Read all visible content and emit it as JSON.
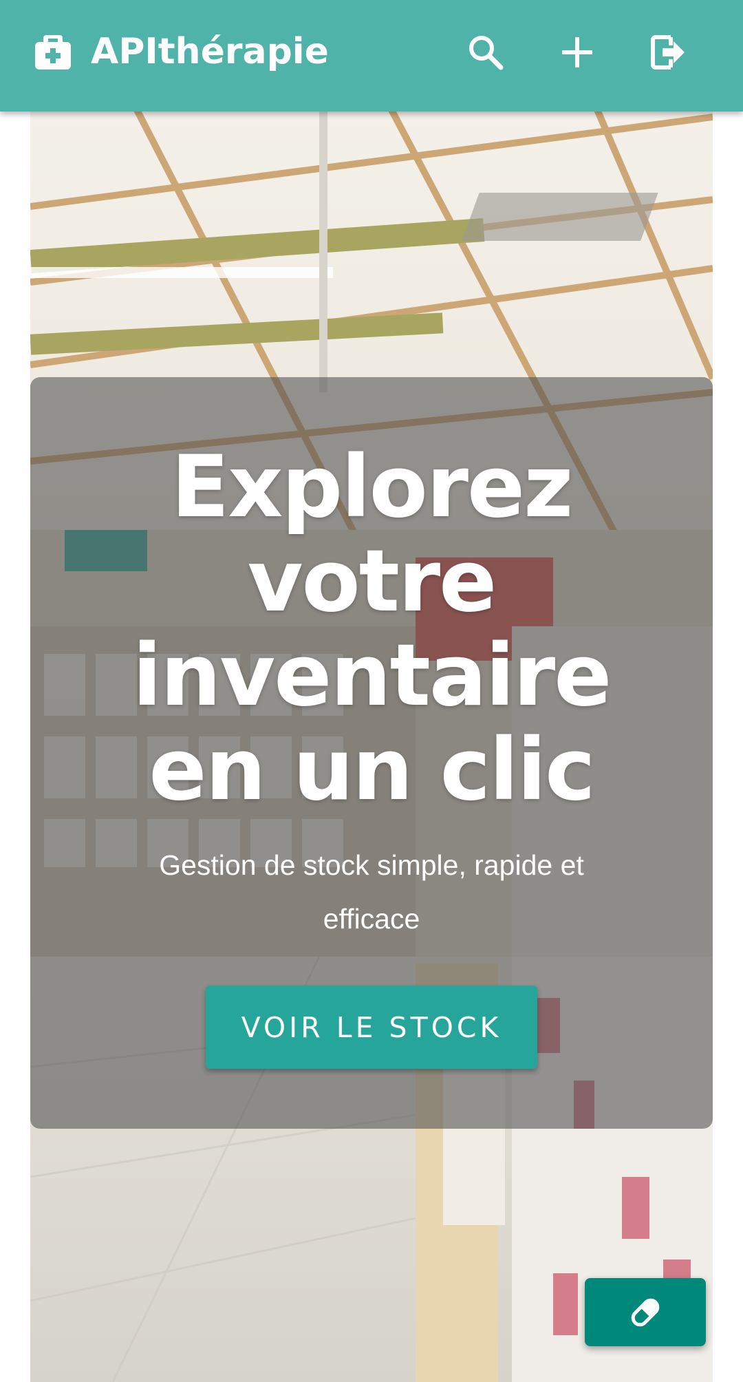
{
  "app": {
    "title": "APIthérapie",
    "bar_color": "#4fb3a9"
  },
  "header": {
    "brand_icon": "medkit-icon",
    "actions": [
      {
        "icon": "search-icon",
        "label": "search"
      },
      {
        "icon": "plus-icon",
        "label": "add"
      },
      {
        "icon": "logout-icon",
        "label": "logout"
      }
    ]
  },
  "hero": {
    "headline_lines": [
      "Explorez",
      "votre",
      "inventaire",
      "en un clic"
    ],
    "subtitle": "Gestion de stock simple, rapide et efficace",
    "cta_label": "VOIR LE STOCK",
    "cta_color": "#26a59a",
    "background": "pharmacy-interior-photo"
  },
  "fab": {
    "icon": "pill-icon",
    "color": "#00897b"
  }
}
